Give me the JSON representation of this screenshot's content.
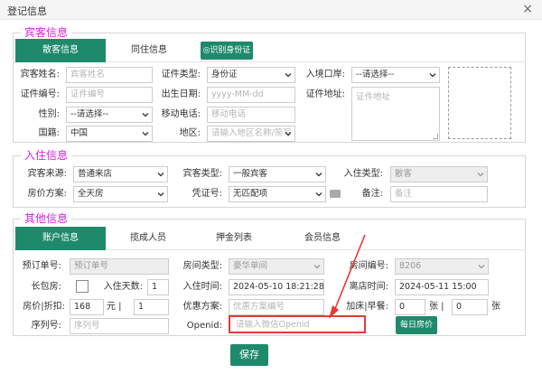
{
  "window": {
    "title": "登记信息",
    "close": "×"
  },
  "guest": {
    "legend": "宾客信息",
    "tabs": [
      "散客信息",
      "同住信息"
    ],
    "id_button": "◎识别身份证",
    "fields": {
      "name": {
        "label": "宾客姓名:",
        "placeholder": "宾客姓名"
      },
      "id_no": {
        "label": "证件编号:",
        "placeholder": "证件编号"
      },
      "gender": {
        "label": "性别:",
        "value": "--请选择--"
      },
      "nationality": {
        "label": "国籍:",
        "value": "中国"
      },
      "id_type": {
        "label": "证件类型:",
        "value": "身份证"
      },
      "birth": {
        "label": "出生日期:",
        "placeholder": "yyyy-MM-dd"
      },
      "mobile": {
        "label": "移动电话:",
        "placeholder": "移动电话"
      },
      "region": {
        "label": "地区:",
        "placeholder": "请输入地区名称/简写"
      },
      "entry_port": {
        "label": "入境口岸:",
        "value": "--请选择--"
      },
      "id_address": {
        "label": "证件地址:",
        "placeholder": "证件地址"
      }
    }
  },
  "checkin": {
    "legend": "入住信息",
    "fields": {
      "source": {
        "label": "宾客来源:",
        "value": "普通来店"
      },
      "plan": {
        "label": "房价方案:",
        "value": "全天房"
      },
      "guest_type": {
        "label": "宾客类型:",
        "value": "一般宾客"
      },
      "voucher": {
        "label": "凭证号:",
        "value": "无匹配项"
      },
      "checkin_type": {
        "label": "入住类型:",
        "value": "散客"
      },
      "remark": {
        "label": "备注:",
        "placeholder": "备注"
      }
    }
  },
  "other": {
    "legend": "其他信息",
    "tabs": [
      "账户信息",
      "揽成人员",
      "押金列表",
      "会员信息"
    ],
    "fields": {
      "booking_no": {
        "label": "预订单号:",
        "placeholder": "预订单号"
      },
      "long_stay": {
        "label": "长包房:"
      },
      "days": {
        "label": "入住天数:",
        "value": "1"
      },
      "rate_discount": {
        "label": "房价|折扣:",
        "value": "168",
        "unit": "元 |",
        "discount": "1"
      },
      "serial": {
        "label": "序列号:",
        "placeholder": "序列号"
      },
      "room_type": {
        "label": "房间类型:",
        "value": "豪华单间"
      },
      "checkin_time": {
        "label": "入住时间:",
        "value": "2024-05-10 18:21:28"
      },
      "promo": {
        "label": "优惠方案:",
        "placeholder": "优惠方案编号"
      },
      "openid": {
        "label": "Openid:",
        "placeholder": "请输入微信Openid"
      },
      "room_no": {
        "label": "房间编号:",
        "value": "8206"
      },
      "checkout_time": {
        "label": "离店时间:",
        "value": "2024-05-11 15:00"
      },
      "extra_bed": {
        "label": "加床|早餐:",
        "bed": "0",
        "unit1": "张 |",
        "breakfast": "0",
        "unit2": "张"
      },
      "daily_rate_btn": "每日房价"
    }
  },
  "save_label": "保存",
  "colors": {
    "accent": "#1e8a6b",
    "legend": "#d81ee0",
    "highlight": "#e53935"
  }
}
